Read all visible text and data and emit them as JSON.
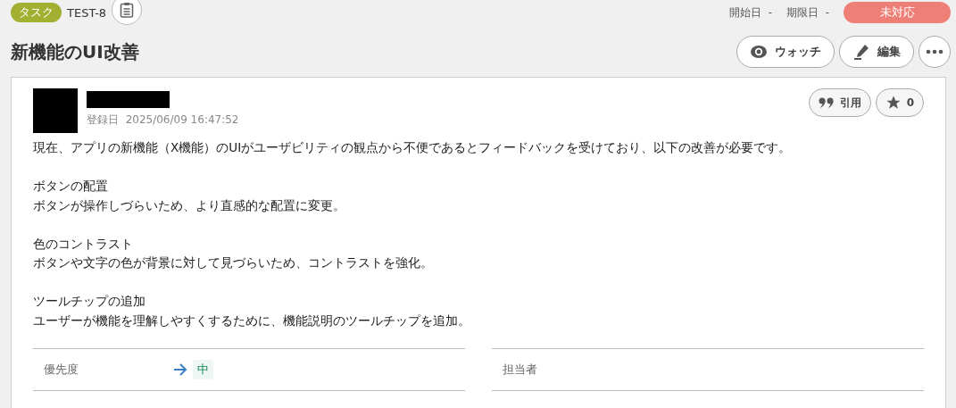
{
  "header": {
    "type_badge": "タスク",
    "issue_key": "TEST-8",
    "start_label": "開始日",
    "start_value": "-",
    "due_label": "期限日",
    "due_value": "-",
    "status": "未対応"
  },
  "title": "新機能のUI改善",
  "actions": [
    {
      "kind": "watch",
      "label": "ウォッチ"
    },
    {
      "kind": "edit",
      "label": "編集"
    },
    {
      "kind": "more"
    }
  ],
  "post": {
    "date_label": "登録日",
    "date": "2025/06/09 16:47:52",
    "quote_label": "引用",
    "star_count": "0",
    "paragraphs": [
      [
        "現在、アプリの新機能（X機能）のUIがユーザビリティの観点から不便であるとフィードバックを受けており、以下の改善が必要です。"
      ],
      [
        "ボタンの配置",
        "ボタンが操作しづらいため、より直感的な配置に変更。"
      ],
      [
        "色のコントラスト",
        "ボタンや文字の色が背景に対して見づらいため、コントラストを強化。"
      ],
      [
        "ツールチップの追加",
        "ユーザーが機能を理解しやすくするために、機能説明のツールチップを追加。"
      ]
    ]
  },
  "fields": [
    {
      "label": "優先度",
      "kind": "priority",
      "value": "中"
    },
    {
      "label": "担当者",
      "kind": "text"
    }
  ]
}
